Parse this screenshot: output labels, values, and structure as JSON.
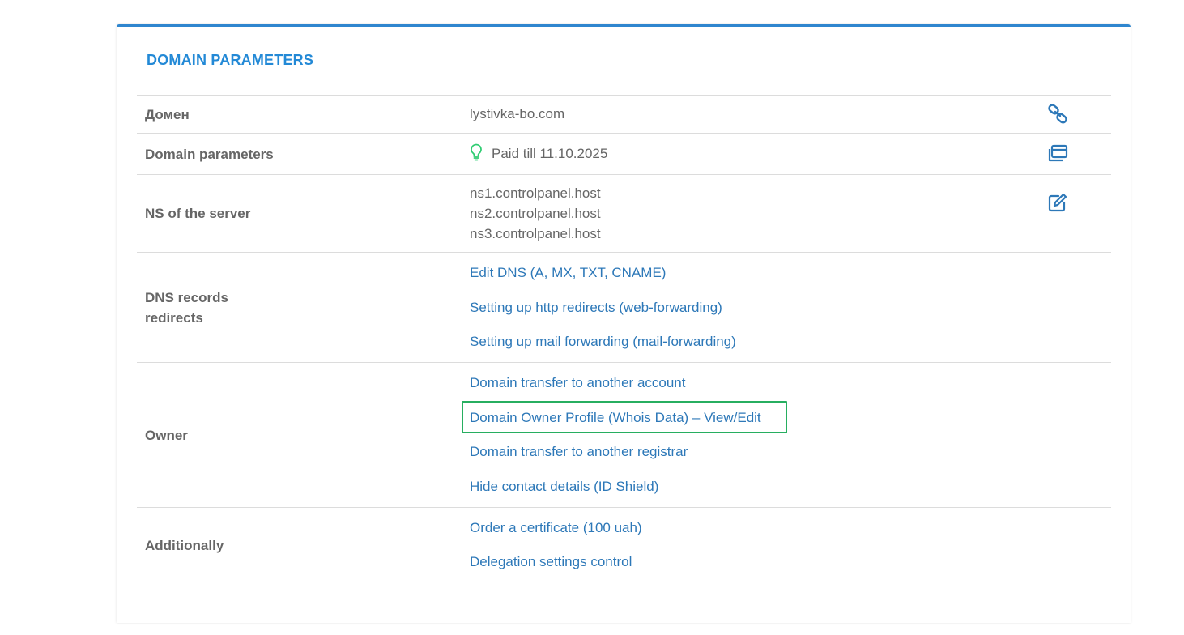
{
  "panel": {
    "title": "DOMAIN PARAMETERS"
  },
  "rows": {
    "domain": {
      "label": "Домен",
      "value": "lystivka-bo.com",
      "icon": "link-icon"
    },
    "params": {
      "label": "Domain parameters",
      "status": "Paid till 11.10.2025",
      "status_icon": "lightbulb-icon",
      "icon": "window-stack-icon"
    },
    "ns": {
      "label": "NS of the server",
      "servers": [
        "ns1.controlpanel.host",
        "ns2.controlpanel.host",
        "ns3.controlpanel.host"
      ],
      "icon": "edit-icon"
    },
    "dns": {
      "label": "DNS records\nredirects",
      "links": [
        "Edit DNS (A, MX, TXT, CNAME)",
        "Setting up http redirects (web-forwarding)",
        "Setting up mail forwarding (mail-forwarding)"
      ]
    },
    "owner": {
      "label": "Owner",
      "links": [
        "Domain transfer to another account",
        "Domain Owner Profile (Whois Data) – View/Edit",
        "Domain transfer to another registrar",
        "Hide contact details (ID Shield)"
      ]
    },
    "additionally": {
      "label": "Additionally",
      "links": [
        "Order a certificate (100 uah)",
        "Delegation settings control"
      ]
    }
  },
  "colors": {
    "accent": "#2389d6",
    "link": "#2d78b8",
    "highlight": "#27ae60",
    "bulb": "#2ecc71"
  }
}
